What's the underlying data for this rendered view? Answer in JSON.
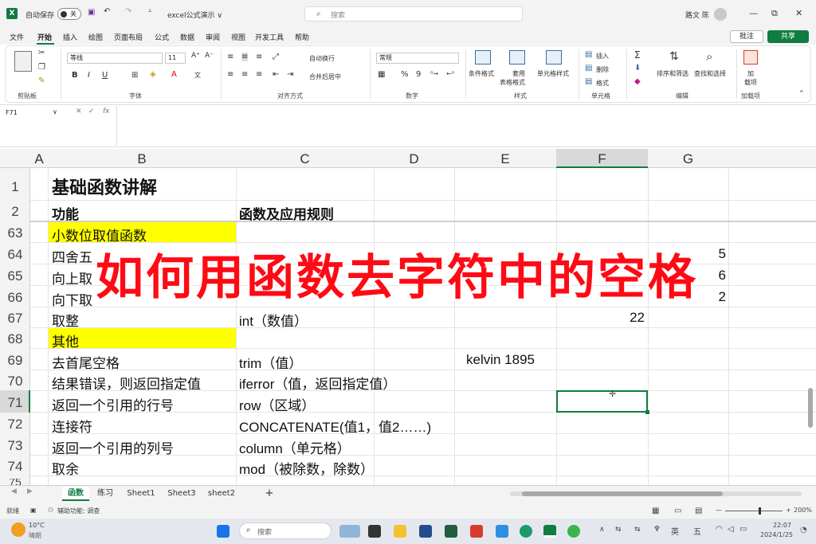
{
  "titlebar": {
    "autosave_label": "自动保存",
    "autosave_state": "关",
    "doc_title": "excel公式演示 ∨",
    "search_placeholder": "搜索",
    "user_name": "路文 陈",
    "minimize": "—",
    "restore": "⧉",
    "close": "✕"
  },
  "menu": {
    "items": [
      "文件",
      "开始",
      "插入",
      "绘图",
      "页面布局",
      "公式",
      "数据",
      "审阅",
      "视图",
      "开发工具",
      "帮助"
    ],
    "active": "开始",
    "comment_label": "批注",
    "share_label": "共享"
  },
  "ribbon": {
    "groups": [
      "剪贴板",
      "字体",
      "对齐方式",
      "数字",
      "样式",
      "单元格",
      "编辑",
      "加载项"
    ],
    "font_name": "等线",
    "font_size": "11",
    "wrap_text": "自动换行",
    "merge_center": "合并后居中",
    "number_format": "常规",
    "cond_format": "条件格式",
    "table_format_1": "套用",
    "table_format_2": "表格格式",
    "cell_styles": "单元格样式",
    "insert": "插入",
    "delete": "删除",
    "format": "格式",
    "sort_filter": "排序和筛选",
    "find_select": "查找和选择",
    "addins_1": "加",
    "addins_2": "载项",
    "font_b": "B",
    "font_i": "I",
    "font_u": "U",
    "percent": "%",
    "comma": "9"
  },
  "formula_bar": {
    "name_box": "F71",
    "fx": "fx",
    "cancel": "✕",
    "confirm": "✓",
    "content": ""
  },
  "grid": {
    "columns": [
      "A",
      "B",
      "C",
      "D",
      "E",
      "F",
      "G"
    ],
    "rows": [
      {
        "num": "1",
        "b": "基础函数讲解",
        "c": "",
        "e": "",
        "f": "",
        "g": ""
      },
      {
        "num": "2",
        "b": "功能",
        "c": "函数及应用规则",
        "e": "",
        "f": "",
        "g": ""
      },
      {
        "num": "63",
        "b": "小数位取值函数",
        "c": "",
        "e": "",
        "f": "",
        "g": ""
      },
      {
        "num": "64",
        "b": "四舍五",
        "c": "",
        "e": "",
        "f": "",
        "g": "5"
      },
      {
        "num": "65",
        "b": "向上取",
        "c": "",
        "e": "",
        "f": "",
        "g": "6"
      },
      {
        "num": "66",
        "b": "向下取",
        "c": "",
        "e": "",
        "f": "",
        "g": "2"
      },
      {
        "num": "67",
        "b": "取整",
        "c": "int（数值）",
        "e": "",
        "f": "22",
        "g": ""
      },
      {
        "num": "68",
        "b": "其他",
        "c": "",
        "e": "",
        "f": "",
        "g": ""
      },
      {
        "num": "69",
        "b": "去首尾空格",
        "c": "trim（值）",
        "e": "kelvin 1895",
        "f": "",
        "g": ""
      },
      {
        "num": "70",
        "b": "结果错误，则返回指定值",
        "c": "iferror（值，返回指定值）",
        "e": "",
        "f": "",
        "g": ""
      },
      {
        "num": "71",
        "b": "返回一个引用的行号",
        "c": "row（区域）",
        "e": "",
        "f": "",
        "g": ""
      },
      {
        "num": "72",
        "b": "连接符",
        "c": "CONCATENATE(值1，值2……)",
        "e": "",
        "f": "",
        "g": ""
      },
      {
        "num": "73",
        "b": "返回一个引用的列号",
        "c": "column（单元格）",
        "e": "",
        "f": "",
        "g": ""
      },
      {
        "num": "74",
        "b": "取余",
        "c": "mod（被除数，除数）",
        "e": "",
        "f": "",
        "g": ""
      },
      {
        "num": "75",
        "b": "",
        "c": "",
        "e": "",
        "f": "",
        "g": ""
      }
    ]
  },
  "overlay_caption": "如何用函数去字符中的空格",
  "sheets": {
    "tabs": [
      "函数",
      "练习",
      "Sheet1",
      "Sheet3",
      "sheet2"
    ],
    "active": "函数",
    "add": "+"
  },
  "status": {
    "ready": "就绪",
    "accessibility": "辅助功能: 调查",
    "zoom": "200%",
    "zoom_minus": "—",
    "zoom_plus": "+"
  },
  "taskbar": {
    "weather_temp": "10°C",
    "weather_desc": "晴朗",
    "search_placeholder": "搜索",
    "ime_lang": "英",
    "ime_mode": "五",
    "time": "22:07",
    "date": "2024/1/25"
  }
}
